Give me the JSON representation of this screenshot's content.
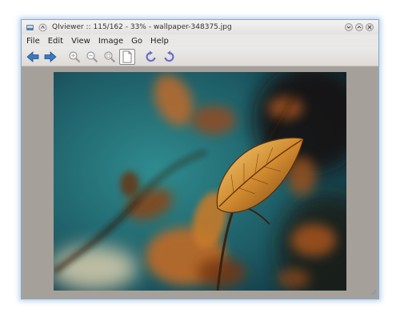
{
  "window": {
    "title": "QIviewer :: 115/162 - 33% - wallpaper-348375.jpg"
  },
  "menubar": {
    "items": [
      "File",
      "Edit",
      "View",
      "Image",
      "Go",
      "Help"
    ]
  },
  "toolbar": {
    "tools": [
      "arrow-left-icon",
      "arrow-right-icon",
      "zoom-in-icon",
      "zoom-out-icon",
      "zoom-fit-icon",
      "original-size-icon",
      "rotate-left-icon",
      "rotate-right-icon"
    ]
  },
  "image": {
    "description_icon": "photo-autumn-leaves"
  },
  "colors": {
    "frame_glow": "#8fa9c3",
    "viewport_bg": "#a6a09b",
    "arrow_blue": "#3b78c4"
  }
}
